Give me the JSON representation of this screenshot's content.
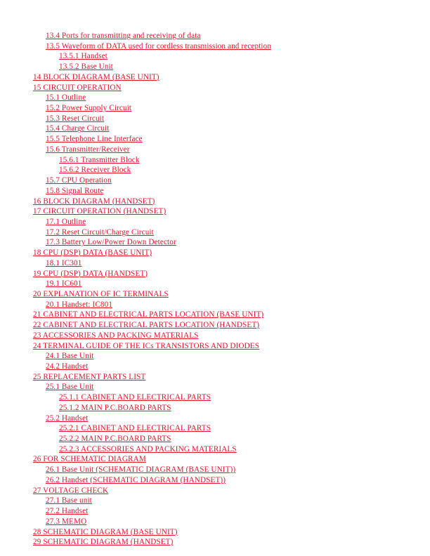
{
  "document": {
    "kind": "table-of-contents",
    "page_background": "#ffffff",
    "link_color": "#e8112d"
  },
  "toc": {
    "entries": [
      {
        "level": 2,
        "label": "13.4 Ports for transmitting and receiving of data"
      },
      {
        "level": 2,
        "label": "13.5 Waveform of DATA used for cordless transmission and reception"
      },
      {
        "level": 3,
        "label": "13.5.1 Handset"
      },
      {
        "level": 3,
        "label": "13.5.2 Base Unit"
      },
      {
        "level": 1,
        "label": "14 BLOCK DIAGRAM (BASE UNIT)"
      },
      {
        "level": 1,
        "label": "15 CIRCUIT OPERATION"
      },
      {
        "level": 2,
        "label": "15.1 Outline"
      },
      {
        "level": 2,
        "label": "15.2 Power Supply Circuit"
      },
      {
        "level": 2,
        "label": "15.3 Reset Circuit"
      },
      {
        "level": 2,
        "label": "15.4 Charge Circuit"
      },
      {
        "level": 2,
        "label": "15.5 Telephone Line Interface"
      },
      {
        "level": 2,
        "label": "15.6 Transmitter/Receiver"
      },
      {
        "level": 3,
        "label": "15.6.1 Transmitter Block"
      },
      {
        "level": 3,
        "label": "15.6.2 Receiver Block"
      },
      {
        "level": 2,
        "label": "15.7 CPU Operation"
      },
      {
        "level": 2,
        "label": "15.8 Signal Route"
      },
      {
        "level": 1,
        "label": "16 BLOCK DIAGRAM (HANDSET)"
      },
      {
        "level": 1,
        "label": "17 CIRCUIT OPERATION (HANDSET)"
      },
      {
        "level": 2,
        "label": "17.1 Outline"
      },
      {
        "level": 2,
        "label": "17.2 Reset Circuit/Charge Circuit"
      },
      {
        "level": 2,
        "label": "17.3 Battery Low/Power Down Detector"
      },
      {
        "level": 1,
        "label": "18 CPU (DSP) DATA (BASE UNIT)"
      },
      {
        "level": 2,
        "label": "18.1 IC301"
      },
      {
        "level": 1,
        "label": "19 CPU (DSP) DATA (HANDSET)"
      },
      {
        "level": 2,
        "label": "19.1 IC601"
      },
      {
        "level": 1,
        "label": "20 EXPLANATION OF IC TERMINALS"
      },
      {
        "level": 2,
        "label": "20.1 Handset: IC801"
      },
      {
        "level": 1,
        "label": "21 CABINET AND ELECTRICAL PARTS LOCATION (BASE UNIT)"
      },
      {
        "level": 1,
        "label": "22 CABINET AND ELECTRICAL PARTS LOCATION (HANDSET)"
      },
      {
        "level": 1,
        "label": "23 ACCESSORIES AND PACKING MATERIALS"
      },
      {
        "level": 1,
        "label": "24 TERMINAL GUIDE OF THE ICs TRANSISTORS AND DIODES"
      },
      {
        "level": 2,
        "label": "24.1 Base Unit"
      },
      {
        "level": 2,
        "label": "24.2 Handset"
      },
      {
        "level": 1,
        "label": "25 REPLACEMENT PARTS LIST"
      },
      {
        "level": 2,
        "label": "25.1 Base Unit"
      },
      {
        "level": 3,
        "label": "25.1.1 CABINET AND ELECTRICAL PARTS"
      },
      {
        "level": 3,
        "label": "25.1.2 MAIN P.C.BOARD PARTS"
      },
      {
        "level": 2,
        "label": "25.2 Handset"
      },
      {
        "level": 3,
        "label": "25.2.1 CABINET AND ELECTRICAL PARTS"
      },
      {
        "level": 3,
        "label": "25.2.2 MAIN P.C.BOARD PARTS"
      },
      {
        "level": 3,
        "label": "25.2.3 ACCESSORIES AND PACKING MATERIALS"
      },
      {
        "level": 1,
        "label": "26 FOR SCHEMATIC DIAGRAM"
      },
      {
        "level": 2,
        "label": "26.1 Base Unit (SCHEMATIC DIAGRAM (BASE UNIT))"
      },
      {
        "level": 2,
        "label": "26.2 Handset (SCHEMATIC DIAGRAM (HANDSET))"
      },
      {
        "level": 1,
        "label": "27 VOLTAGE CHECK"
      },
      {
        "level": 2,
        "label": "27.1 Base unit"
      },
      {
        "level": 2,
        "label": "27.2 Handset"
      },
      {
        "level": 2,
        "label": "27.3 MEMO"
      },
      {
        "level": 1,
        "label": "28 SCHEMATIC DIAGRAM (BASE UNIT)"
      },
      {
        "level": 1,
        "label": "29 SCHEMATIC DIAGRAM (HANDSET)"
      }
    ]
  }
}
